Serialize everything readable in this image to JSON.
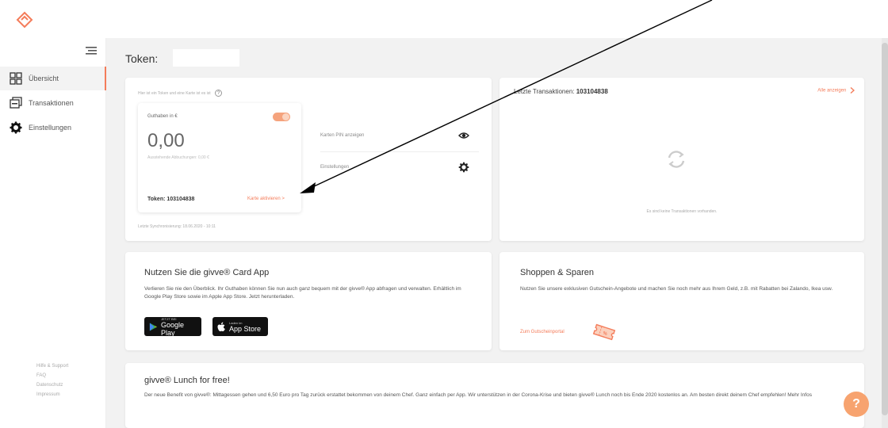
{
  "colors": {
    "accent": "#f47c5a",
    "background": "#f2f2f2",
    "card": "#ffffff",
    "help_fab": "#f7a36f"
  },
  "sidebar": {
    "items": [
      {
        "label": "Übersicht",
        "icon": "grid-icon",
        "active": true
      },
      {
        "label": "Transaktionen",
        "icon": "transactions-icon",
        "active": false
      },
      {
        "label": "Einstellungen",
        "icon": "gear-icon",
        "active": false
      }
    ],
    "footer_links": [
      "Hilfe & Support",
      "FAQ",
      "Datenschutz",
      "Impressum"
    ]
  },
  "page": {
    "title": "Token:"
  },
  "token_card": {
    "hint": "Hier ist ein Token und eine Karte ist es ist",
    "balance_label": "Guthaben in €",
    "balance": "0,00",
    "available": "Ausstehende Abbuchungen: 0,00 €",
    "token": "Token: 103104838",
    "activate_link": "Karte aktivieren >",
    "last_update": "Letzte Synchronisierung: 18.06.2020 - 10:11",
    "pin_label": "Karten PIN anzeigen",
    "settings_label": "Einstellungen"
  },
  "transactions": {
    "title_prefix": "Letzte Transaktionen:",
    "token": "103104838",
    "all_link": "Alle anzeigen",
    "empty": "Es sind keine Transaktionen vorhanden."
  },
  "app_card": {
    "title": "Nutzen Sie die givve® Card App",
    "text": "Verlieren Sie nie den Überblick. Ihr Guthaben können Sie nun auch ganz bequem mit der givve® App abfragen und verwalten. Erhältlich im Google Play Store sowie im Apple App Store. Jetzt herunterladen.",
    "google_small": "JETZT BEI",
    "google_large": "Google Play",
    "apple_small": "Laden im",
    "apple_large": "App Store"
  },
  "shop_card": {
    "title": "Shoppen & Sparen",
    "text": "Nutzen Sie unsere exklusiven Gutschein-Angebote und machen Sie noch mehr aus Ihrem Geld, z.B. mit Rabatten bei Zalando, Ikea usw.",
    "link": "Zum Gutscheinportal"
  },
  "lunch_card": {
    "title": "givve® Lunch for free!",
    "text": "Der neue Benefit von givve®: Mittagessen gehen und 6,50 Euro pro Tag zurück erstattet bekommen von deinem Chef. Ganz einfach per App. Wir unterstützen in der Corona-Krise und bieten givve® Lunch noch bis Ende 2020 kostenlos an. Am besten direkt deinem Chef empfehlen! Mehr Infos"
  },
  "help_fab": "?"
}
